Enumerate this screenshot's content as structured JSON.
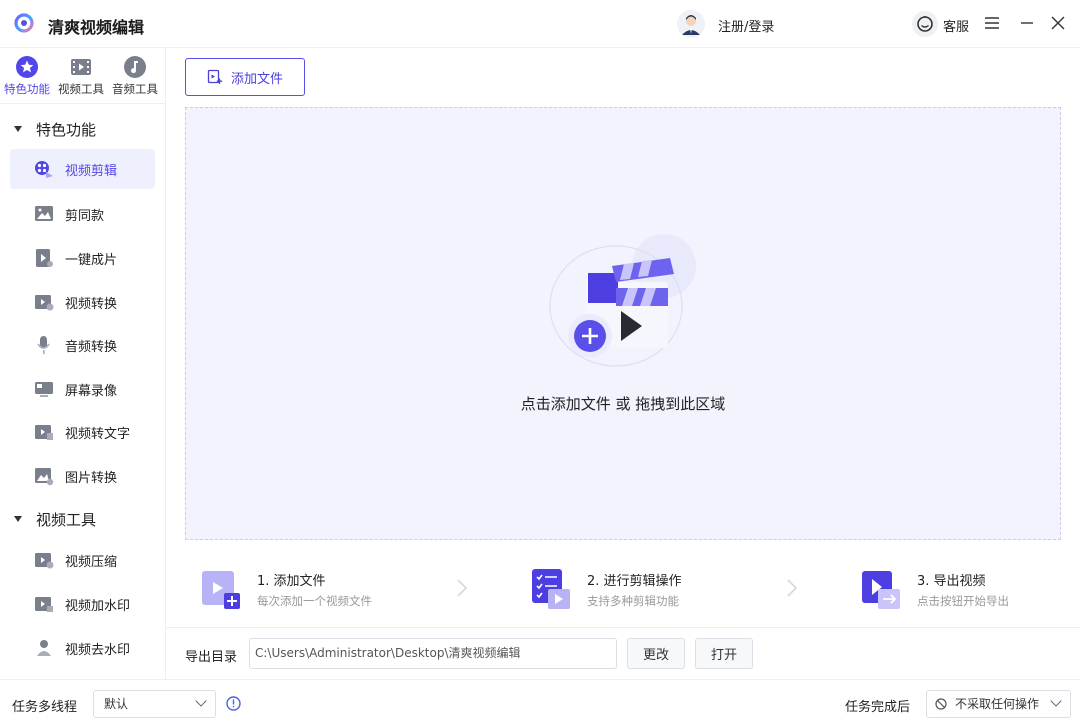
{
  "window": {
    "title": "清爽视频编辑",
    "login_label": "注册/登录",
    "service_label": "客服",
    "accent": "#5246e8"
  },
  "sidebar": {
    "top_tabs": [
      {
        "label": "特色功能",
        "icon": "star-icon",
        "active": true
      },
      {
        "label": "视频工具",
        "icon": "film-icon",
        "active": false
      },
      {
        "label": "音频工具",
        "icon": "music-icon",
        "active": false
      }
    ],
    "groups": [
      {
        "title": "特色功能",
        "items": [
          {
            "label": "视频剪辑",
            "icon": "video-edit-icon",
            "active": true
          },
          {
            "label": "剪同款",
            "icon": "image-icon"
          },
          {
            "label": "一键成片",
            "icon": "play-doc-icon"
          },
          {
            "label": "视频转换",
            "icon": "video-convert-icon"
          },
          {
            "label": "音频转换",
            "icon": "microphone-icon"
          },
          {
            "label": "屏幕录像",
            "icon": "screen-record-icon"
          },
          {
            "label": "视频转文字",
            "icon": "video-text-icon"
          },
          {
            "label": "图片转换",
            "icon": "image-convert-icon"
          }
        ]
      },
      {
        "title": "视频工具",
        "items": [
          {
            "label": "视频压缩",
            "icon": "video-compress-icon"
          },
          {
            "label": "视频加水印",
            "icon": "video-watermark-icon"
          },
          {
            "label": "视频去水印",
            "icon": "remove-watermark-icon"
          }
        ]
      }
    ]
  },
  "main": {
    "add_file_label": "添加文件",
    "drop_text": "点击添加文件 或 拖拽到此区域",
    "steps": [
      {
        "title": "1. 添加文件",
        "desc": "每次添加一个视频文件"
      },
      {
        "title": "2. 进行剪辑操作",
        "desc": "支持多种剪辑功能"
      },
      {
        "title": "3. 导出视频",
        "desc": "点击按钮开始导出"
      }
    ],
    "export": {
      "label": "导出目录",
      "path": "C:\\Users\\Administrator\\Desktop\\清爽视频编辑",
      "change_label": "更改",
      "open_label": "打开"
    }
  },
  "bottom": {
    "thread_label": "任务多线程",
    "thread_value": "默认",
    "after_label": "任务完成后",
    "after_value": "不采取任何操作"
  }
}
